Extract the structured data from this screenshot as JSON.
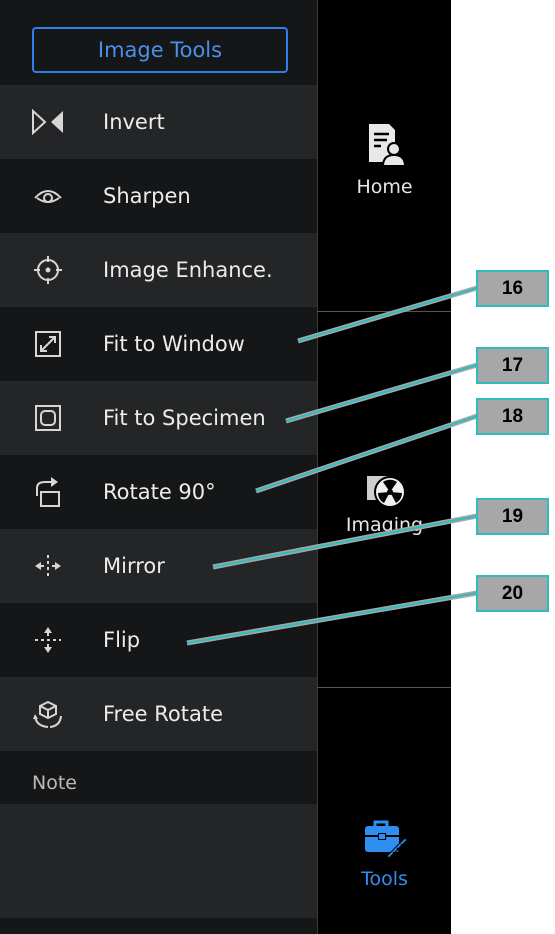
{
  "panel": {
    "title": "Image Tools",
    "items": [
      {
        "label": "Invert",
        "icon": "invert-icon"
      },
      {
        "label": "Sharpen",
        "icon": "eye-icon"
      },
      {
        "label": "Image Enhance.",
        "icon": "target-icon"
      },
      {
        "label": "Fit to Window",
        "icon": "fit-window-icon"
      },
      {
        "label": "Fit to Specimen",
        "icon": "fit-specimen-icon"
      },
      {
        "label": "Rotate 90°",
        "icon": "rotate-icon"
      },
      {
        "label": "Mirror",
        "icon": "mirror-icon"
      },
      {
        "label": "Flip",
        "icon": "flip-icon"
      },
      {
        "label": "Free Rotate",
        "icon": "free-rotate-icon"
      }
    ],
    "note_label": "Note"
  },
  "sidebar": {
    "home": "Home",
    "imaging": "Imaging",
    "tools": "Tools"
  },
  "callouts": [
    "16",
    "17",
    "18",
    "19",
    "20"
  ],
  "colors": {
    "accent": "#2f8ff0",
    "callout_border": "#2fbcbc",
    "callout_fill": "#a7a7a7"
  }
}
